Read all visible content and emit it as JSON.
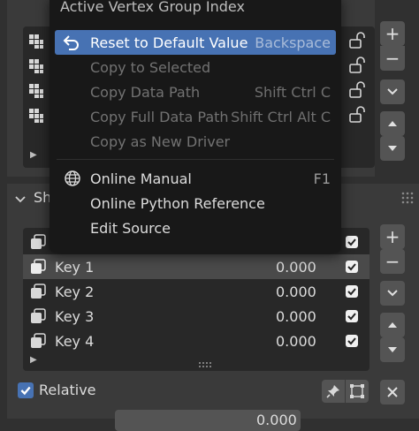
{
  "vertex_groups": {
    "count": 4
  },
  "shape_keys": {
    "header_label": "Sh",
    "keys": [
      {
        "name": "",
        "value": "",
        "checked": true
      },
      {
        "name": "Key 1",
        "value": "0.000",
        "checked": true
      },
      {
        "name": "Key 2",
        "value": "0.000",
        "checked": true
      },
      {
        "name": "Key 3",
        "value": "0.000",
        "checked": true
      },
      {
        "name": "Key 4",
        "value": "0.000",
        "checked": true
      }
    ],
    "relative_label": "Relative",
    "bottom_value": "0.000"
  },
  "context_menu": {
    "title": "Active Vertex Group Index",
    "items": [
      {
        "label": "Reset to Default Value",
        "shortcut": "Backspace",
        "underline": "R",
        "highlighted": true
      },
      {
        "label": "Copy to Selected",
        "shortcut": "",
        "disabled": true
      },
      {
        "label": "Copy Data Path",
        "shortcut": "Shift Ctrl C",
        "disabled": true
      },
      {
        "label": "Copy Full Data Path",
        "shortcut": "Shift Ctrl Alt C",
        "disabled": true
      },
      {
        "label": "Copy as New Driver",
        "shortcut": "",
        "disabled": true
      },
      {
        "label": "Online Manual",
        "shortcut": "F1"
      },
      {
        "label": "Online Python Reference",
        "shortcut": ""
      },
      {
        "label": "Edit Source",
        "shortcut": ""
      }
    ]
  },
  "colors": {
    "highlight": "#4772b3",
    "checkbox_blue": "#4772b3"
  }
}
